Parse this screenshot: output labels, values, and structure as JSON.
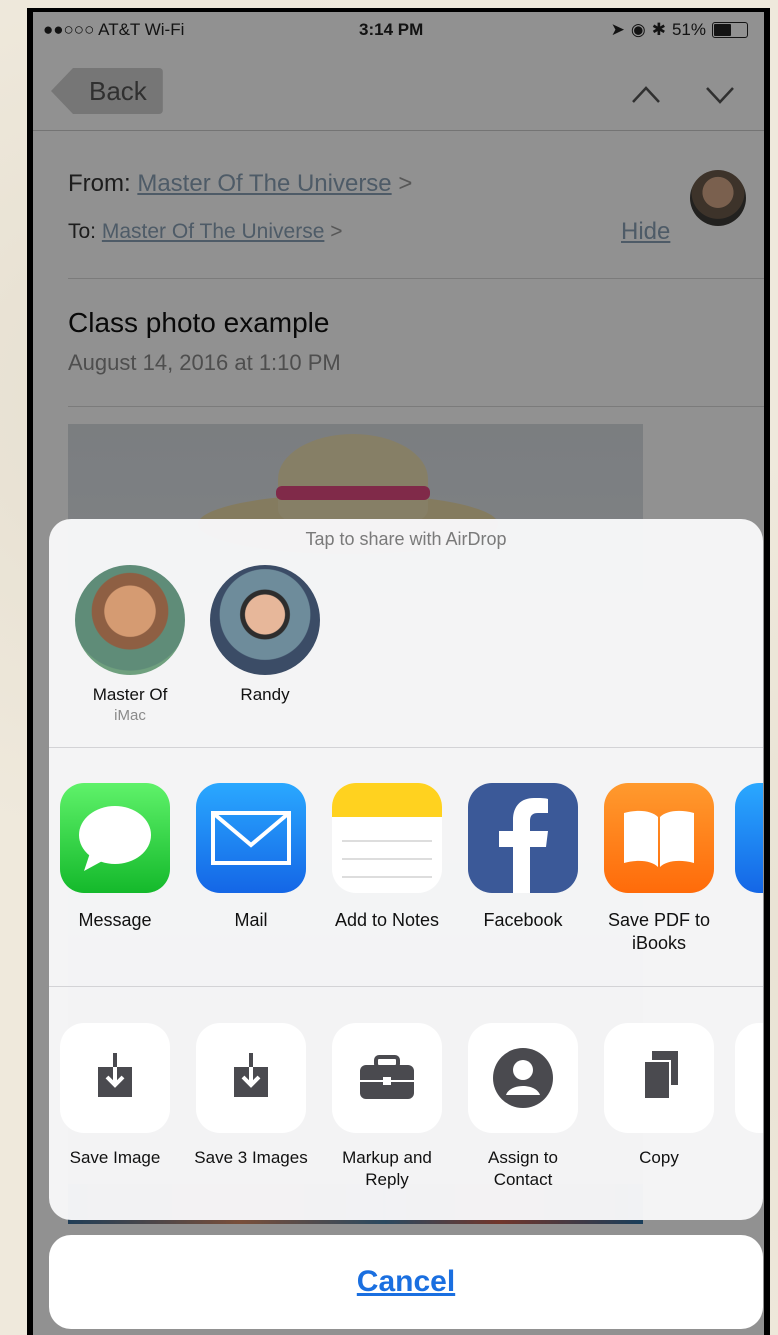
{
  "status_bar": {
    "carrier": "●●○○○ AT&T Wi-Fi",
    "time": "3:14 PM",
    "battery": "51%",
    "battery_level": 0.51
  },
  "nav": {
    "back_label": "Back"
  },
  "email": {
    "from_label": "From:",
    "from_name": "Master Of The Universe",
    "to_label": "To:",
    "to_name": "Master Of The Universe",
    "hide_label": "Hide",
    "subject": "Class photo example",
    "date": "August 14, 2016 at 1:10 PM"
  },
  "share_sheet": {
    "airdrop_title": "Tap to share with AirDrop",
    "contacts": [
      {
        "name": "Master Of",
        "subtitle": "iMac"
      },
      {
        "name": "Randy",
        "subtitle": ""
      }
    ],
    "apps": [
      {
        "label": "Message",
        "icon": "messages-icon"
      },
      {
        "label": "Mail",
        "icon": "mail-icon"
      },
      {
        "label": "Add to Notes",
        "icon": "notes-icon"
      },
      {
        "label": "Facebook",
        "icon": "facebook-icon"
      },
      {
        "label": "Save PDF to iBooks",
        "icon": "ibooks-icon"
      }
    ],
    "actions": [
      {
        "label": "Save Image",
        "icon": "save-image-icon"
      },
      {
        "label": "Save 3 Images",
        "icon": "save-images-icon"
      },
      {
        "label": "Markup and Reply",
        "icon": "toolbox-icon"
      },
      {
        "label": "Assign to Contact",
        "icon": "contact-icon"
      },
      {
        "label": "Copy",
        "icon": "copy-icon"
      }
    ],
    "cancel_label": "Cancel"
  },
  "colors": {
    "link": "#8aa1b6",
    "cancel": "#1a6fe0",
    "facebook": "#3b5998",
    "books": "#ff7a12"
  }
}
